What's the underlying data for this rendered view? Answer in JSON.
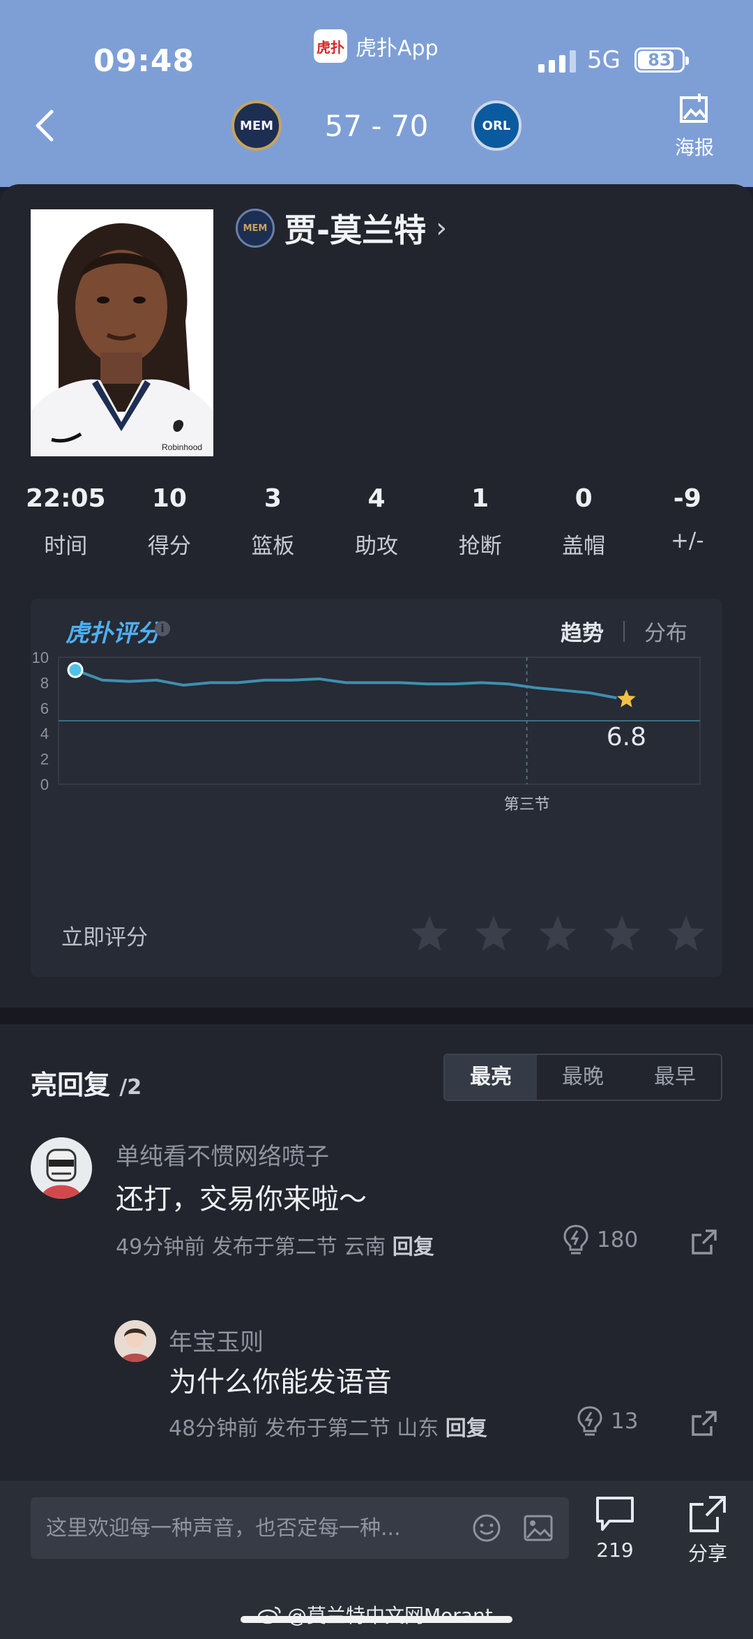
{
  "status_bar": {
    "time": "09:48",
    "app_name": "虎扑App",
    "app_logo_text": "虎扑",
    "network": "5G",
    "battery": "83",
    "battery_level": 0.83
  },
  "header": {
    "home_team": "MEM",
    "away_team": "ORL",
    "score": "57 - 70",
    "poster_label": "海报"
  },
  "player": {
    "name": "贾-莫兰特",
    "jersey_sponsor": "Robinhood",
    "stats": [
      {
        "value": "22:05",
        "label": "时间"
      },
      {
        "value": "10",
        "label": "得分"
      },
      {
        "value": "3",
        "label": "篮板"
      },
      {
        "value": "4",
        "label": "助攻"
      },
      {
        "value": "1",
        "label": "抢断"
      },
      {
        "value": "0",
        "label": "盖帽"
      },
      {
        "value": "-9",
        "label": "+/-"
      }
    ]
  },
  "rating": {
    "brand": "虎扑评分",
    "brand_mark": "®",
    "tab_trend": "趋势",
    "tab_distribution": "分布",
    "rate_now": "立即评分",
    "star_count": 5
  },
  "chart_data": {
    "type": "line",
    "ylim": [
      0,
      10
    ],
    "yticks": [
      "0",
      "2",
      "4",
      "6",
      "8",
      "10"
    ],
    "x_marker_label": "第三节",
    "x_marker_position": 0.73,
    "reference_y": 5,
    "series": [
      {
        "values": [
          9.0,
          8.2,
          8.1,
          8.2,
          7.8,
          8.0,
          8.0,
          8.2,
          8.2,
          8.3,
          8.0,
          8.0,
          8.0,
          7.9,
          7.9,
          8.0,
          7.9,
          7.6,
          7.4,
          7.2,
          6.8
        ]
      }
    ],
    "final_value": "6.8"
  },
  "replies": {
    "title": "亮回复",
    "count": "/2",
    "sort": [
      "最亮",
      "最晚",
      "最早"
    ],
    "items": [
      {
        "user": "单纯看不惯网络喷子",
        "text": "还打，交易你来啦～",
        "time": "49分钟前 发布于第二节 云南",
        "reply": "回复",
        "likes": "180"
      },
      {
        "user": "年宝玉则",
        "text": "为什么你能发语音",
        "time": "48分钟前 发布于第二节 山东",
        "reply": "回复",
        "likes": "13"
      }
    ]
  },
  "bottom": {
    "placeholder": "这里欢迎每一种声音，也否定每一种...",
    "comments_count": "219",
    "share_label": "分享",
    "watermark": "@莫兰特中文网Morant"
  },
  "colors": {
    "header_bg": "#7e9fd6",
    "page_bg": "#22252d",
    "accent_line": "#3f8fb0",
    "star": "#f3c145",
    "dot": "#4fc2e8"
  }
}
